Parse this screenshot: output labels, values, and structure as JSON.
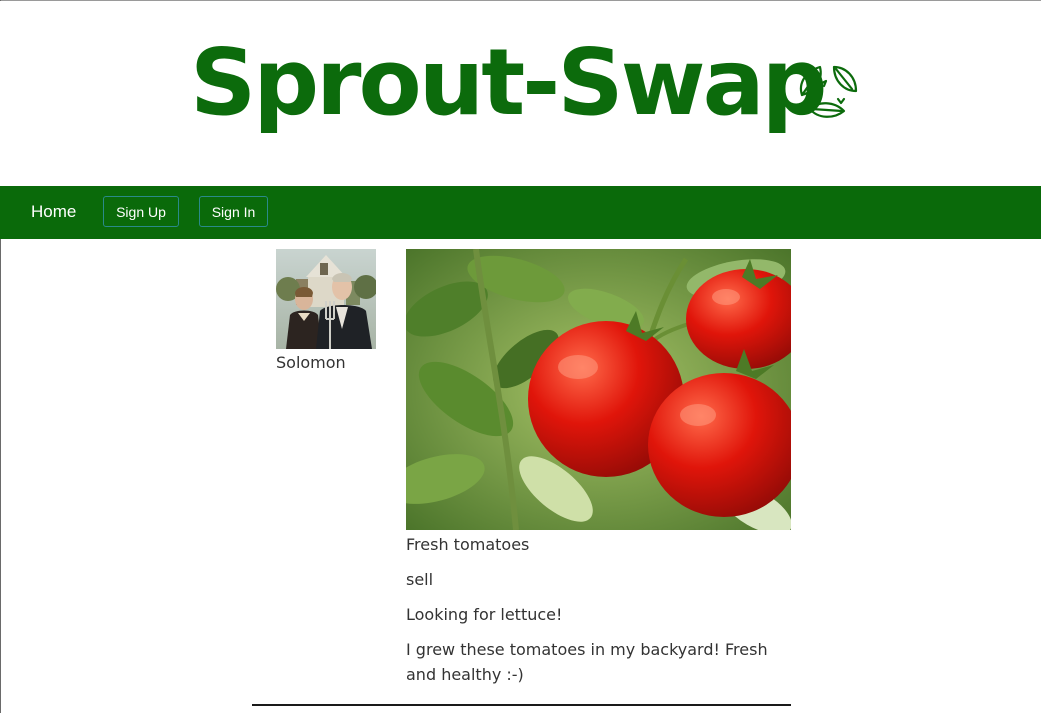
{
  "site": {
    "title": "Sprout-Swap",
    "brand_color": "#0c6b0c",
    "logo_icon": "recycle-leaves-icon"
  },
  "nav": {
    "background": "#0a6a0a",
    "home_label": "Home",
    "signup_label": "Sign Up",
    "signin_label": "Sign In"
  },
  "post": {
    "user": {
      "name": "Solomon",
      "avatar": "american-gothic-avatar"
    },
    "image": "tomatoes-on-vine-photo",
    "title": "Fresh tomatoes",
    "type": "sell",
    "want": "Looking for lettuce!",
    "description": "I grew these tomatoes in my backyard! Fresh and healthy :-)"
  }
}
